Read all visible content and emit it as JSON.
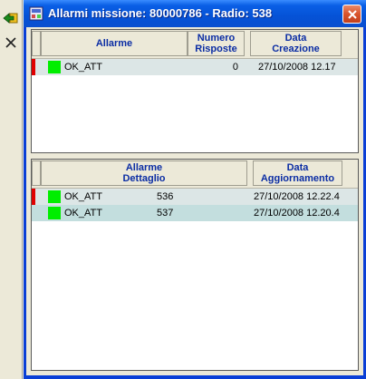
{
  "window": {
    "title": "Allarmi missione: 80000786 - Radio: 538"
  },
  "left_toolbar": {
    "icons": [
      "back-arrow-icon",
      "close-x-icon"
    ]
  },
  "alarms_table": {
    "headers": {
      "alarm": "Allarme",
      "responses": "Numero\nRisposte",
      "created": "Data\nCreazione"
    },
    "rows": [
      {
        "alarm": "OK_ATT",
        "responses": "0",
        "created": "27/10/2008 12.17",
        "flag_color": "#e00000",
        "status_color": "#00ee00"
      }
    ]
  },
  "detail_table": {
    "headers": {
      "detail": "Allarme\nDettaglio",
      "updated": "Data\nAggiornamento"
    },
    "rows": [
      {
        "alarm": "OK_ATT",
        "code": "536",
        "updated": "27/10/2008 12.22.4",
        "flagged": true,
        "flag_color": "#e00000",
        "status_color": "#00ee00"
      },
      {
        "alarm": "OK_ATT",
        "code": "537",
        "updated": "27/10/2008 12.20.4",
        "flagged": false,
        "status_color": "#00ee00"
      }
    ]
  },
  "colors": {
    "titlebar": "#0552d6",
    "header_text": "#0b2da4",
    "row_selected_bg": "#c3dede",
    "row_bg": "#dce6e6"
  }
}
